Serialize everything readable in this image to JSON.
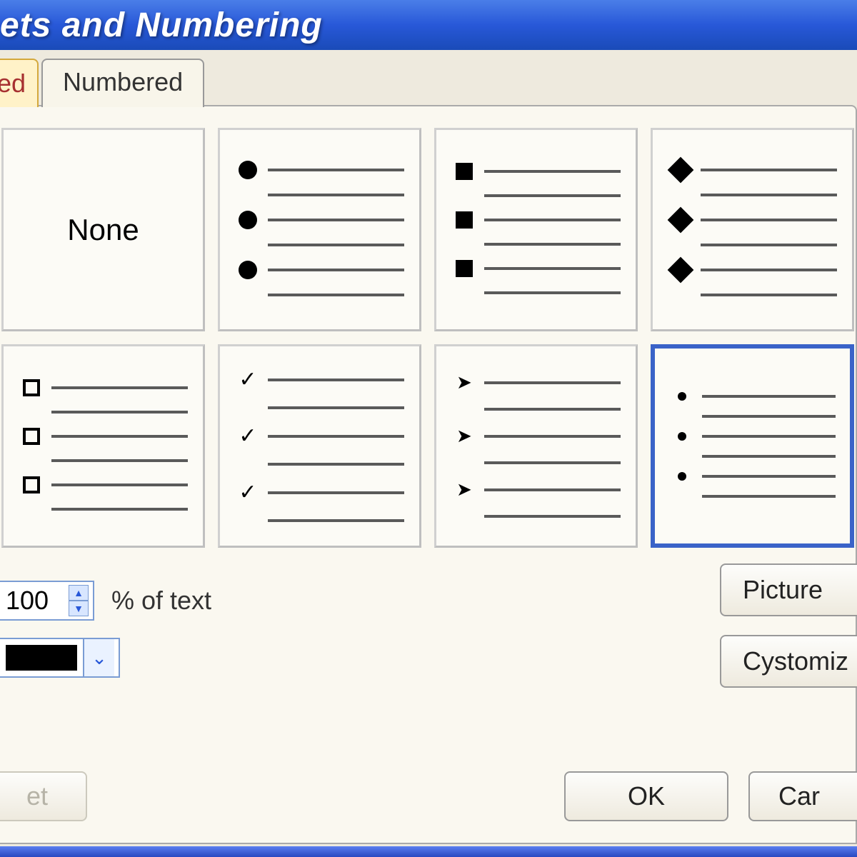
{
  "title": "ets and Numbering",
  "tabs": {
    "bulleted_partial": "ed",
    "numbered": "Numbered"
  },
  "options": {
    "none": "None"
  },
  "size": {
    "value": "100",
    "suffix": "% of text"
  },
  "buttons": {
    "picture": "Picture",
    "customize": "Cystomiz",
    "reset_partial": "et",
    "ok": "OK",
    "cancel_partial": "Car"
  },
  "icons": {
    "up": "▲",
    "down": "▼",
    "dropdown": "⌄"
  }
}
